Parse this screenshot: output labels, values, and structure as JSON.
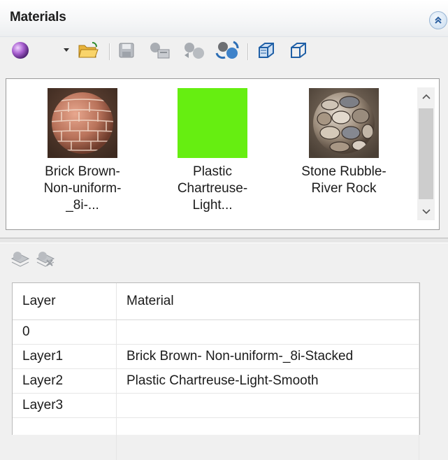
{
  "panel": {
    "title": "Materials",
    "collapse_icon": "double-chevron-up-icon"
  },
  "toolbar": {
    "icons": [
      "material-sphere-icon",
      "dropdown-arrow-icon",
      "open-folder-icon",
      "save-icon",
      "copy-material-icon",
      "assign-material-icon",
      "synchronize-icon",
      "view-box-shaded-icon",
      "view-box-wireframe-icon"
    ]
  },
  "swatches": [
    {
      "label": "Brick Brown-\nNon-uniform-_8i-...",
      "thumbnail": "brick-sphere"
    },
    {
      "label": "Plastic\nChartreuse-Light...",
      "thumbnail": "flat-color",
      "color": "#66ee11"
    },
    {
      "label": "Stone Rubble-\nRiver Rock",
      "thumbnail": "stone-sphere"
    }
  ],
  "layer_toolbar": {
    "icons": [
      "assign-to-layer-icon",
      "remove-from-layer-icon"
    ]
  },
  "table": {
    "headers": [
      "Layer",
      "Material"
    ],
    "rows": [
      {
        "layer": "0",
        "material": ""
      },
      {
        "layer": "Layer1",
        "material": "Brick Brown- Non-uniform-_8i-Stacked"
      },
      {
        "layer": "Layer2",
        "material": "Plastic Chartreuse-Light-Smooth"
      },
      {
        "layer": "Layer3",
        "material": ""
      }
    ]
  }
}
